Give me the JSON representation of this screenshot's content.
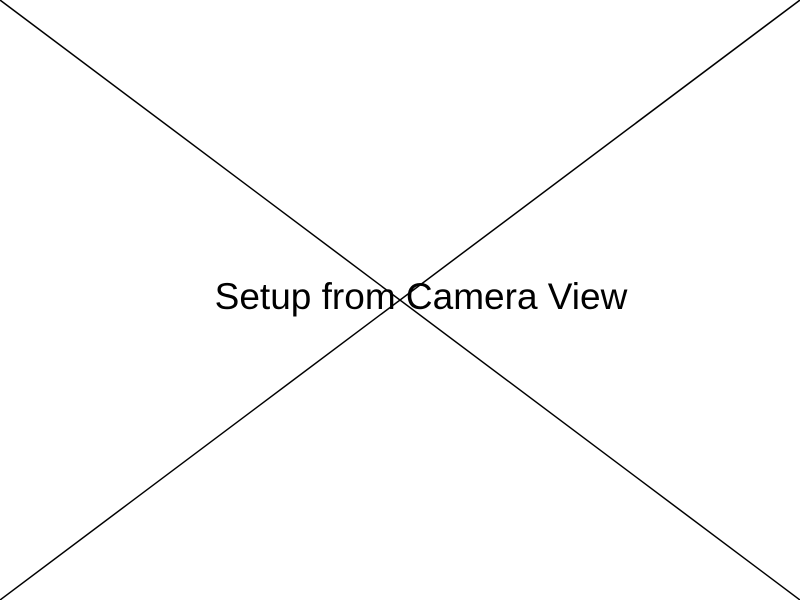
{
  "placeholder": {
    "caption": "Setup from Camera View",
    "line_color": "#000000",
    "background_color": "#ffffff"
  }
}
